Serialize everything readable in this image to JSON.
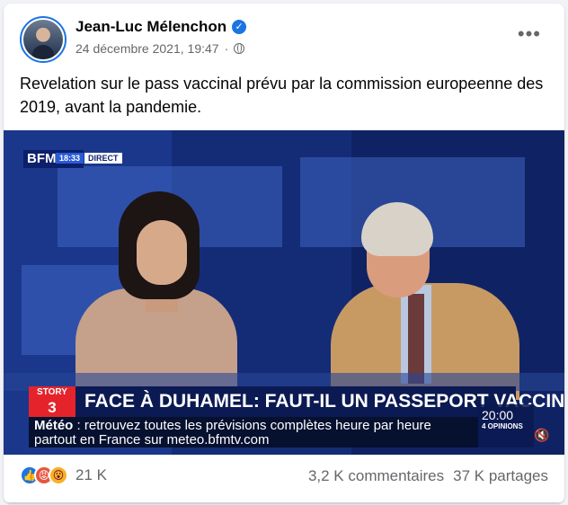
{
  "post": {
    "author": "Jean-Luc Mélenchon",
    "verified_icon": "verified-check-icon",
    "date": "24 décembre 2021, 19:47",
    "separator": "·",
    "privacy_icon": "globe-icon",
    "more_label": "•••",
    "text": "Revelation sur le pass vaccinal prévu par la commission europeenne des 2019, avant la pandemie."
  },
  "video": {
    "channel_logo": "BFM TV.",
    "channel_time": "18:33",
    "channel_live": "DIRECT",
    "story_label": "STORY",
    "story_number": "3",
    "headline": "FACE À DUHAMEL: FAUT-IL UN PASSEPORT VACCINAL?",
    "ticker_label": "Météo",
    "ticker_line1": ": retrouvez toutes les prévisions complètes heure par heure",
    "ticker_line2": "partout en France sur meteo.bfmtv.com",
    "clock": "20:00",
    "clock_sub": "4 OPINIONS",
    "mute_icon": "mute-icon"
  },
  "footer": {
    "reactions": [
      "like-icon",
      "angry-icon",
      "wow-icon"
    ],
    "reaction_count": "21 K",
    "comments": "3,2 K commentaires",
    "shares": "37 K partages"
  },
  "colors": {
    "facebook_blue": "#1b74e4",
    "text_secondary": "#65676b",
    "bfm_red": "#e4232b",
    "bfm_navy": "#0b1a52"
  }
}
